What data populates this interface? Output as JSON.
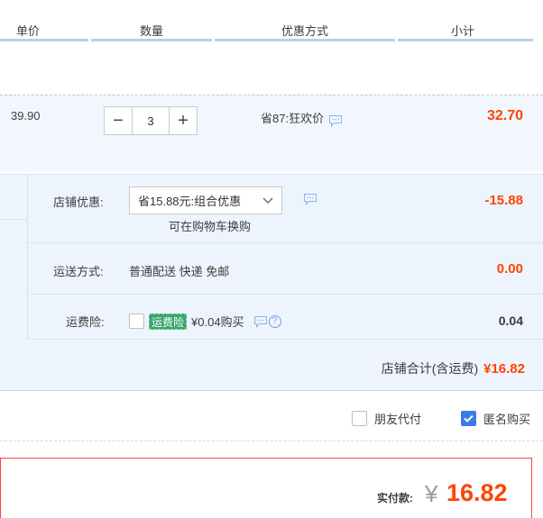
{
  "header": {
    "col_price": "单价",
    "col_qty": "数量",
    "col_promo": "优惠方式",
    "col_subtotal": "小计"
  },
  "item": {
    "price": "39.90",
    "qty_minus": "−",
    "qty_value": "3",
    "qty_plus": "+",
    "promo": "省87:狂欢价",
    "subtotal": "32.70"
  },
  "shop": {
    "discount_label": "店铺优惠:",
    "discount_selected": "省15.88元:组合优惠",
    "discount_link": "可在购物车换购",
    "discount_value": "-15.88",
    "shipping_label": "运送方式:",
    "shipping_text": "普通配送 快递 免邮",
    "shipping_value": "0.00",
    "insurance_label": "运费险:",
    "insurance_badge": "运费险",
    "insurance_text": "¥0.04购买",
    "insurance_value": "0.04",
    "total_label": "店铺合计(含运费)",
    "total_value": "¥16.82"
  },
  "options": {
    "friend_pay": "朋友代付",
    "anonymous": "匿名购买"
  },
  "pay": {
    "label": "实付款:",
    "yen": "¥",
    "amount": "16.82"
  },
  "colors": {
    "accent_red": "#ff4400",
    "checkbox_blue": "#3b7de6",
    "badge_green": "#3aa66e"
  },
  "icons": {
    "chat": "chat-bubble-icon",
    "chevron": "chevron-down-icon",
    "help": "question-circle-icon",
    "check": "checkmark-icon"
  }
}
